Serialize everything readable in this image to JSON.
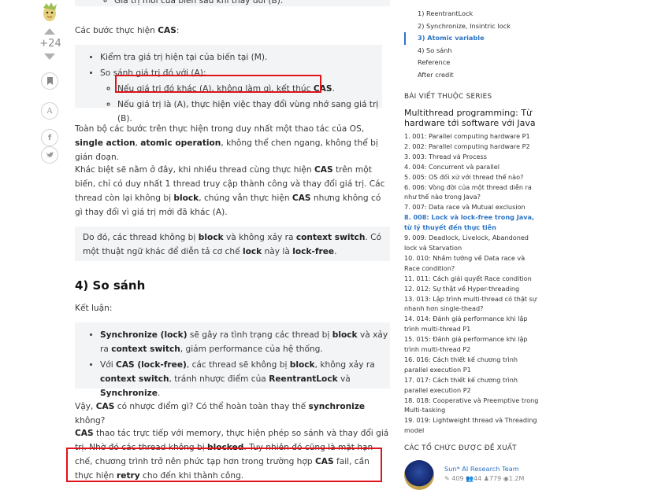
{
  "article": {
    "top_cut": "Giá trị mới của biến sau khi thay đổi (B).",
    "steps_title": "Các bước thực hiện",
    "steps": [
      "Kiểm tra giá trị hiện tại của biến tại (M).",
      "So sánh giá trị đó với (A):"
    ],
    "sub_steps": [
      "Nếu giá trị đó khác (A), không làm gì, kết thúc",
      "Nếu giá trị là (A), thực hiện việc thay đổi vùng nhớ sang giá trị (B)."
    ],
    "p1_start": "Toàn bộ các bước trên thực hiện trong duy nhất một thao tác của OS,",
    "p1_b1": "single action",
    "p1_b2": "atomic operation",
    "p1_end": ", không thể chen ngang, không thể bị gián đoạn.",
    "p2_a": "Khác biệt sẽ nằm ở đây, khi nhiều thread cùng thực hiện",
    "p2_b": "trên một biến, chỉ có duy nhất 1 thread truy cập thành công và thay đổi giá trị. Các thread còn lại không bị",
    "p2_c": ", chúng vẫn thực hiện",
    "p2_d": "nhưng không có gì thay đổi vì giá trị mới đã khác (A).",
    "block": "block",
    "cas": "CAS",
    "quote_a": "Do đó, các thread không bị",
    "quote_b": "và không xảy ra",
    "quote_c": "context switch",
    "quote_d": ". Có một thuật ngữ khác để diễn tả cơ chế",
    "quote_e": "lock",
    "quote_f": "này là",
    "quote_g": "lock-free",
    "heading": "4) So sánh",
    "conclusion": "Kết luận:",
    "c1_a": "Synchronize (lock)",
    "c1_b": "sẽ gây ra tình trạng các thread bị",
    "c1_c": "và xảy ra",
    "c1_d": "context switch",
    "c1_e": ", giảm performance của hệ thống.",
    "c2_a": "Với",
    "c2_b": "CAS (lock-free)",
    "c2_c": ", các thread sẽ không bị",
    "c2_d": ", không xảy ra",
    "c2_e": "context switch",
    "c2_f": ", tránh nhược điểm của",
    "c2_g": "ReentrantLock",
    "c2_h": "và",
    "c2_i": "Synchronize",
    "q_a": "Vậy,",
    "q_b": "có nhược điểm gì? Có thể hoàn toàn thay thế",
    "q_c": "synchronize",
    "q_d": "không?",
    "last_a": "thao tác trực tiếp với memory, thực hiện phép so sánh và thay đổi giá trị. Nhờ đó các thread không bị",
    "last_b": "blocked",
    "last_c": ". Tuy nhiên đó cũng là mặt hạn chế, chương trình trở nên phức tạp hơn trong trường hợp",
    "last_d": "fail, cần thực hiện",
    "last_e": "retry",
    "last_f": "cho đến khi thành công."
  },
  "rail": {
    "votes": "+24"
  },
  "toc": {
    "items": [
      "1) ReentrantLock",
      "2) Synchronize, Insintric lock",
      "3) Atomic variable",
      "4) So sánh",
      "Reference",
      "After credit"
    ],
    "active_index": 2
  },
  "series": {
    "section_title": "BÀI VIẾT THUỘC SERIES",
    "title": "Multithread programming: Từ hardware tới software với Java",
    "items": [
      "1. 001: Parallel computing hardware P1",
      "2. 002: Parallel computing hardware P2",
      "3. 003: Thread và Process",
      "4. 004: Concurrent và parallel",
      "5. 005: OS đối xử với thread thế nào?",
      "6. 006: Vòng đời của một thread diễn ra như thế nào trong Java?",
      "7. 007: Data race và Mutual exclusion",
      "8. 008: Lock và lock-free trong Java, từ lý thuyết đến thực tiễn",
      "9. 009: Deadlock, Livelock, Abandoned lock và Starvation",
      "10. 010: Nhầm tưởng về Data race và Race condition?",
      "11. 011: Cách giải quyết Race condition",
      "12. 012: Sự thật về Hyper-threading",
      "13. 013: Lập trình multi-thread có thật sự nhanh hơn single-thead?",
      "14. 014: Đánh giá performance khi lập trình multi-thread P1",
      "15. 015: Đánh giá performance khi lập trình multi-thread P2",
      "16. 016: Cách thiết kế chương trình parallel execution P1",
      "17. 017: Cách thiết kế chương trình parallel execution P2",
      "18. 018: Cooperative và Preemptive trong Multi-tasking",
      "19. 019: Lightweight thread và Threading model"
    ],
    "active_index": 7
  },
  "orgs": {
    "section_title": "CÁC TỔ CHỨC ĐƯỢC ĐỀ XUẤT",
    "name": "Sun* AI Research Team",
    "stats": [
      "409",
      "44",
      "779",
      "1.2M"
    ]
  },
  "colors": {
    "accent": "#2d74c4",
    "highlight": "#e0131b",
    "quote_bg": "#f3f4f6"
  }
}
